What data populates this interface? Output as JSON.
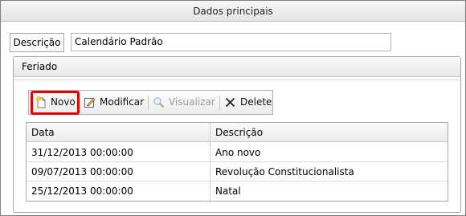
{
  "window": {
    "title": "Dados principais"
  },
  "form": {
    "descricao_label": "Descrição",
    "descricao_value": "Calendário Padrão"
  },
  "feriado": {
    "title": "Feriado",
    "toolbar": {
      "novo": "Novo",
      "modificar": "Modificar",
      "visualizar": "Visualizar",
      "delete": "Delete"
    },
    "table": {
      "headers": [
        "Data",
        "Descrição"
      ],
      "rows": [
        [
          "31/12/2013 00:00:00",
          "Ano novo"
        ],
        [
          "09/07/2013 00:00:00",
          "Revolução Constitucionalista"
        ],
        [
          "25/12/2013 00:00:00",
          "Natal"
        ]
      ]
    }
  },
  "colors": {
    "highlight": "#e00000"
  },
  "icons": [
    "new-document-icon",
    "edit-icon",
    "magnifier-icon",
    "delete-x-icon"
  ]
}
